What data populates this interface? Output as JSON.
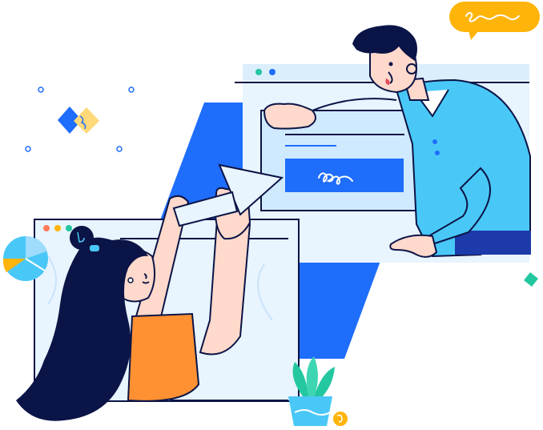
{
  "palette": {
    "primary_blue": "#1f6dfb",
    "light_blue": "#cfeaff",
    "window_bg": "#e8f4fe",
    "cyan": "#49c8f7",
    "navy": "#0b1446",
    "orange": "#ff9133",
    "yellow": "#ffb40a",
    "green": "#23c7a0",
    "skin": "#ffd9cb",
    "white": "#ffffff"
  },
  "icons": {
    "speech_bubble": "speech-bubble-icon",
    "pie_chart": "pie-chart-icon",
    "diamond_pair": "diamond-icon",
    "plant": "plant-icon",
    "coin": "coin-icon"
  }
}
